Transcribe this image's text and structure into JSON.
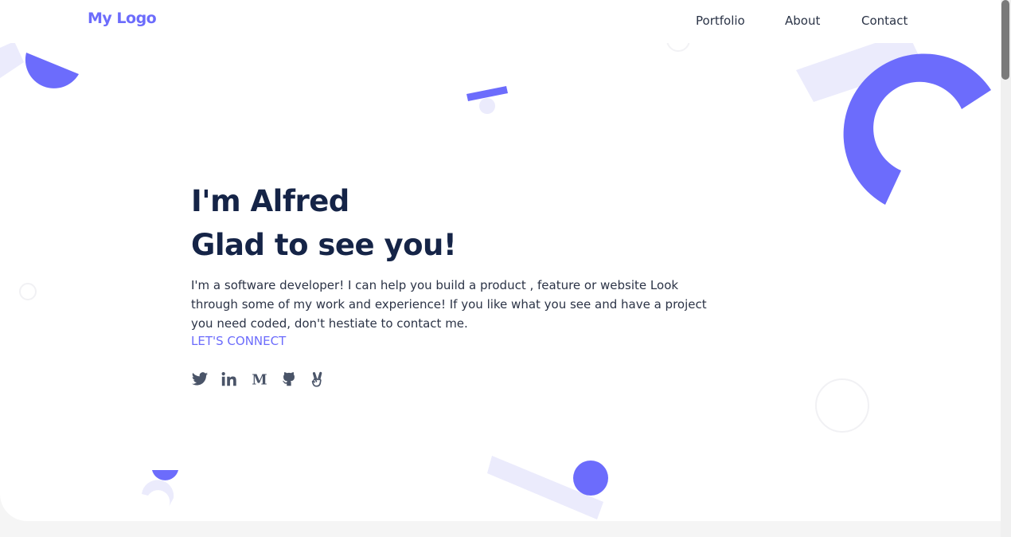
{
  "header": {
    "logo": "My Logo",
    "nav": [
      {
        "label": "Portfolio"
      },
      {
        "label": "About"
      },
      {
        "label": "Contact"
      }
    ]
  },
  "hero": {
    "line1": "I'm Alfred",
    "line2": "Glad to see you!",
    "bio": "I'm a software developer! I can help you build a product , feature or website Look through some of my work and experience! If you like what you see and have a project you need coded, don't hestiate to contact me.",
    "cta": "LET'S CONNECT"
  },
  "socials": [
    {
      "icon": "twitter-icon"
    },
    {
      "icon": "linkedin-icon"
    },
    {
      "icon": "medium-icon",
      "glyph": "M"
    },
    {
      "icon": "github-icon"
    },
    {
      "icon": "angellist-icon"
    }
  ],
  "colors": {
    "accent": "#6c6cfc",
    "accent_light": "#ebebfc",
    "heading": "#152447",
    "text": "#2b3346",
    "icon": "#4a5468"
  }
}
